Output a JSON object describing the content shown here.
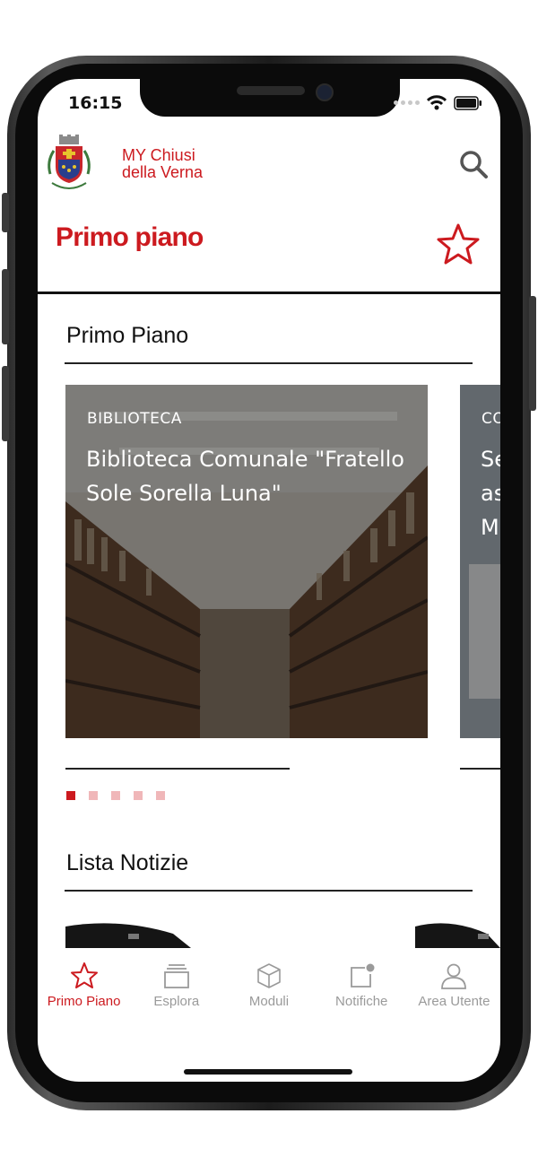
{
  "status": {
    "time": "16:15"
  },
  "header": {
    "brand_line1": "MY Chiusi",
    "brand_line2": "della Verna",
    "page_title": "Primo piano"
  },
  "sections": {
    "primo_piano": "Primo Piano",
    "lista_notizie": "Lista Notizie"
  },
  "carousel": {
    "cards": [
      {
        "category": "BIBLIOTECA",
        "title": "Biblioteca Comunale \"Fratello Sole Sorella Luna\""
      },
      {
        "category": "CO",
        "title": "Se as M"
      }
    ],
    "dot_count": 5,
    "active_dot": 0
  },
  "tabs": [
    {
      "label": "Primo Piano",
      "icon": "star-icon",
      "active": true
    },
    {
      "label": "Esplora",
      "icon": "cards-icon",
      "active": false
    },
    {
      "label": "Moduli",
      "icon": "cube-icon",
      "active": false
    },
    {
      "label": "Notifiche",
      "icon": "notification-icon",
      "active": false
    },
    {
      "label": "Area Utente",
      "icon": "user-icon",
      "active": false
    }
  ],
  "colors": {
    "accent": "#cc1a1f",
    "inactive_tab": "#9a9a9a",
    "dot_inactive": "#f0b7b9"
  }
}
